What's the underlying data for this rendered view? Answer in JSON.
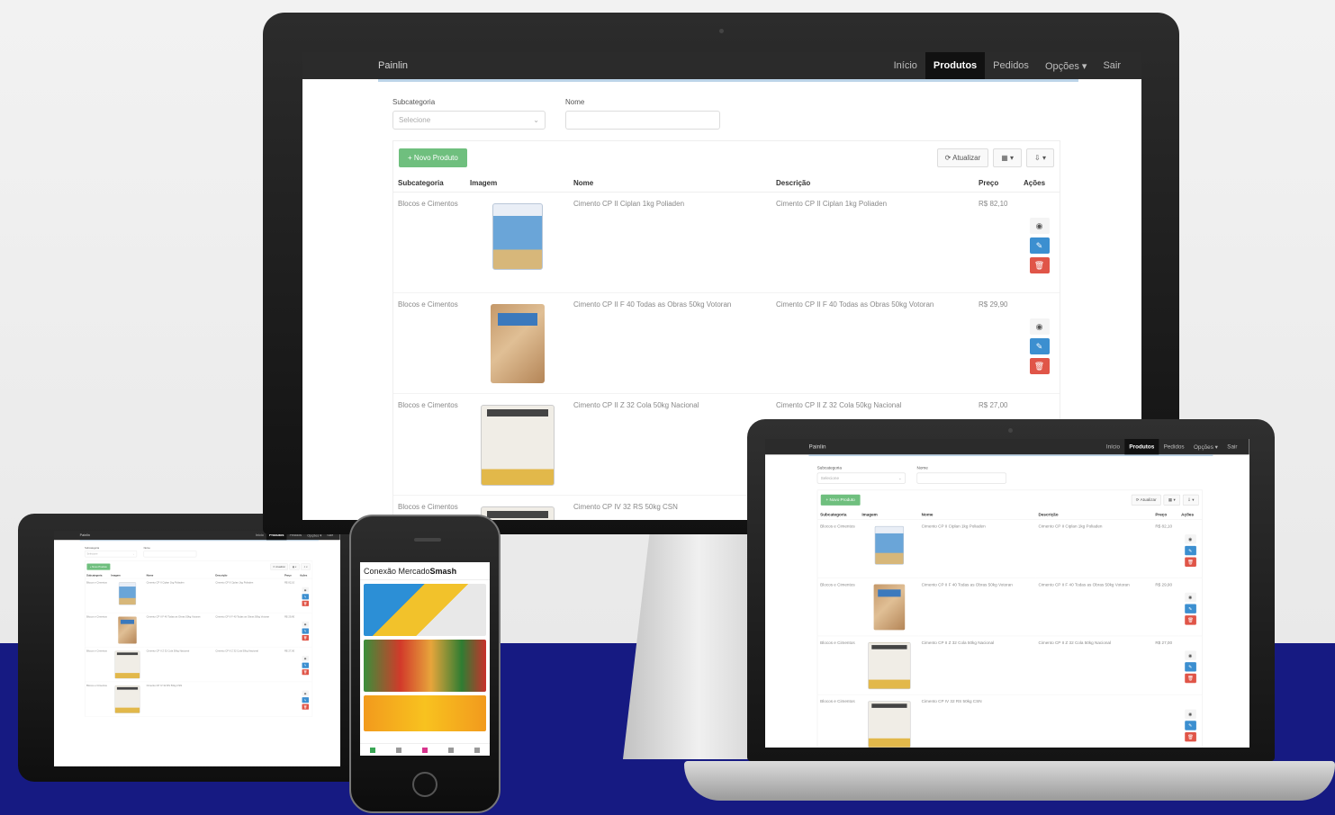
{
  "app": {
    "brand": "Painlin",
    "nav": [
      "Início",
      "Produtos",
      "Pedidos",
      "Opções ▾",
      "Sair"
    ],
    "active_nav": 1,
    "filters": {
      "category_label": "Subcategoria",
      "category_placeholder": "Selecione",
      "name_label": "Nome"
    },
    "new_button": "+ Novo Produto",
    "tools": [
      "⟳ Atualizar",
      "▦ ▾",
      "⇩ ▾"
    ],
    "columns": [
      "Subcategoria",
      "Imagem",
      "Nome",
      "Descrição",
      "Preço",
      "Ações"
    ],
    "rows": [
      {
        "subcategory": "Blocos e Cimentos",
        "name": "Cimento CP II Ciplan 1kg Poliaden",
        "description": "Cimento CP II Ciplan 1kg Poliaden",
        "price": "R$ 82,10",
        "image": "bag-blue"
      },
      {
        "subcategory": "Blocos e Cimentos",
        "name": "Cimento CP II F 40 Todas as Obras 50kg Votoran",
        "description": "Cimento CP II F 40 Todas as Obras 50kg Votoran",
        "price": "R$ 29,90",
        "image": "bag-kraft"
      },
      {
        "subcategory": "Blocos e Cimentos",
        "name": "Cimento CP II Z 32 Cola 50kg Nacional",
        "description": "Cimento CP II Z 32 Cola 50kg Nacional",
        "price": "R$ 27,00",
        "image": "bag-white"
      },
      {
        "subcategory": "Blocos e Cimentos",
        "name": "Cimento CP IV 32 RS 50kg CSN",
        "description": "",
        "price": "",
        "image": "bag-white"
      }
    ]
  },
  "phone": {
    "header_light": "Conexão Mercado",
    "header_bold": "Smash",
    "banners": [
      "groceries",
      "vegetables",
      "oils"
    ]
  },
  "colors": {
    "navbar": "#2b2b2b",
    "new_button": "#6fbf7e",
    "edit": "#3c8fd0",
    "delete": "#e05548",
    "floor": "#161a82"
  }
}
